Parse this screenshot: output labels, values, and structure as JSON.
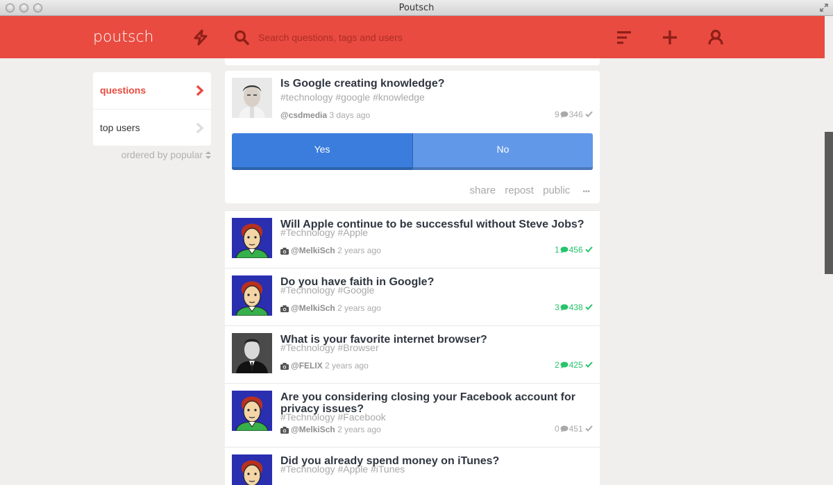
{
  "window": {
    "title": "Poutsch"
  },
  "header": {
    "logo": "poutsch",
    "search_placeholder": "Search questions, tags and users",
    "icons": [
      "lightning-icon",
      "search-icon",
      "sort-icon",
      "plus-icon",
      "user-icon"
    ],
    "color": "#e94b40"
  },
  "sidebar": {
    "items": [
      {
        "label": "questions",
        "active": true
      },
      {
        "label": "top users",
        "active": false
      }
    ],
    "ordered_by": "ordered by popular"
  },
  "featured": {
    "title": "Is Google creating knowledge?",
    "tags": "#technology #google #knowledge",
    "user": "@csdmedia",
    "time": "3 days ago",
    "comments": "9",
    "votes": "346",
    "yes_label": "Yes",
    "no_label": "No",
    "actions": {
      "share": "share",
      "repost": "repost",
      "public": "public",
      "more": "•••"
    }
  },
  "questions": [
    {
      "title": "Will Apple continue to be successful without Steve Jobs?",
      "tags": "#Technology #Apple",
      "user": "@MelkiSch",
      "time": "2 years ago",
      "comments": "1",
      "votes": "456",
      "answered": true,
      "avatar": "cartoon"
    },
    {
      "title": "Do you have faith in Google?",
      "tags": "#Technology #Google",
      "user": "@MelkiSch",
      "time": "2 years ago",
      "comments": "3",
      "votes": "438",
      "answered": true,
      "avatar": "cartoon"
    },
    {
      "title": "What is your favorite internet browser?",
      "tags": "#Technology #Browser",
      "user": "@FELIX",
      "time": "2 years ago",
      "comments": "2",
      "votes": "425",
      "answered": true,
      "avatar": "photo"
    },
    {
      "title": "Are you considering closing your Facebook account for privacy issues?",
      "tags": "#Technology #Facebook",
      "user": "@MelkiSch",
      "time": "2 years ago",
      "comments": "0",
      "votes": "451",
      "answered": false,
      "avatar": "cartoon"
    },
    {
      "title": "Did you already spend money on iTunes?",
      "tags": "#Technology #Apple #iTunes",
      "user": "",
      "time": "",
      "comments": "",
      "votes": "",
      "answered": false,
      "avatar": "cartoon"
    }
  ],
  "colors": {
    "accent": "#e94b40",
    "answered": "#27c46b",
    "yes": "#3a7ddc",
    "no": "#6298e8"
  }
}
